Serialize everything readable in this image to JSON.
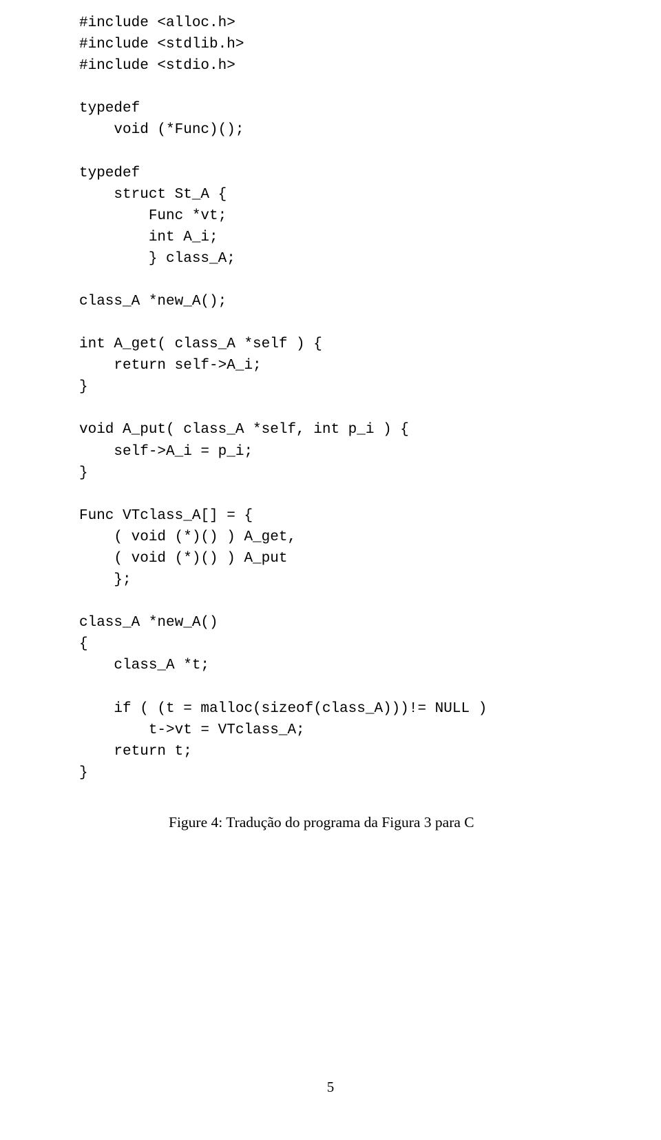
{
  "code": {
    "lines": [
      "#include <alloc.h>",
      "#include <stdlib.h>",
      "#include <stdio.h>",
      "",
      "typedef",
      "    void (*Func)();",
      "",
      "typedef",
      "    struct St_A {",
      "        Func *vt;",
      "        int A_i;",
      "        } class_A;",
      "",
      "class_A *new_A();",
      "",
      "int A_get( class_A *self ) {",
      "    return self->A_i;",
      "}",
      "",
      "void A_put( class_A *self, int p_i ) {",
      "    self->A_i = p_i;",
      "}",
      "",
      "Func VTclass_A[] = {",
      "    ( void (*)() ) A_get,",
      "    ( void (*)() ) A_put",
      "    };",
      "",
      "class_A *new_A()",
      "{",
      "    class_A *t;",
      "",
      "    if ( (t = malloc(sizeof(class_A)))!= NULL )",
      "        t->vt = VTclass_A;",
      "    return t;",
      "}"
    ]
  },
  "caption": "Figure 4: Tradução do programa da Figura 3 para C",
  "pageNumber": "5"
}
